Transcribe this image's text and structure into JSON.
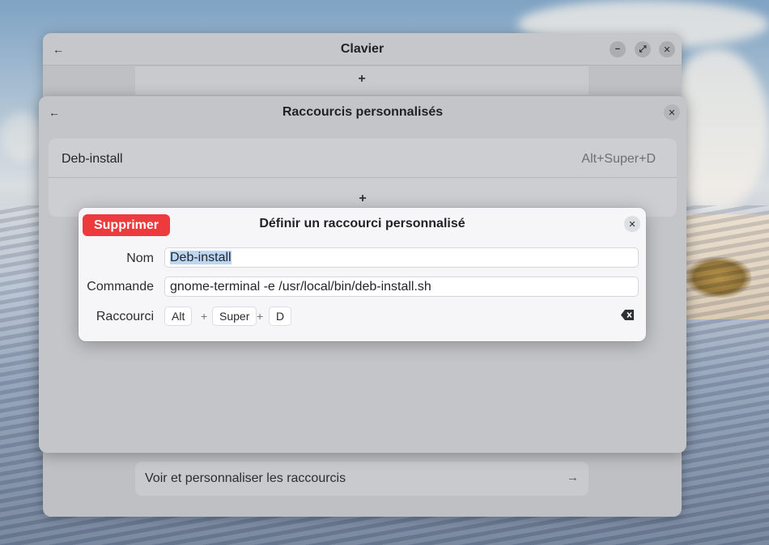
{
  "clavier_window": {
    "title": "Clavier",
    "add_symbol": "+",
    "bottom_row_label": "Voir et personnaliser les raccourcis",
    "bottom_row_arrow": "→",
    "back_icon": "arrow-left-icon",
    "min_icon": "minimize-icon",
    "max_icon": "maximize-icon",
    "close_icon": "close-icon"
  },
  "raccourcis_window": {
    "title": "Raccourcis personnalisés",
    "add_symbol": "+",
    "rows": [
      {
        "name": "Deb-install",
        "accel": "Alt+Super+D"
      }
    ]
  },
  "dialog": {
    "title": "Définir un raccourci personnalisé",
    "delete_label": "Supprimer",
    "delete_color": "#ec3a3d",
    "name_label": "Nom",
    "name_value": "Deb-install",
    "command_label": "Commande",
    "command_value": "gnome-terminal -e /usr/local/bin/deb-install.sh",
    "shortcut_label": "Raccourci",
    "keys": [
      "Alt",
      "Super",
      "D"
    ],
    "key_separator": "+",
    "clear_icon": "backspace-icon"
  }
}
